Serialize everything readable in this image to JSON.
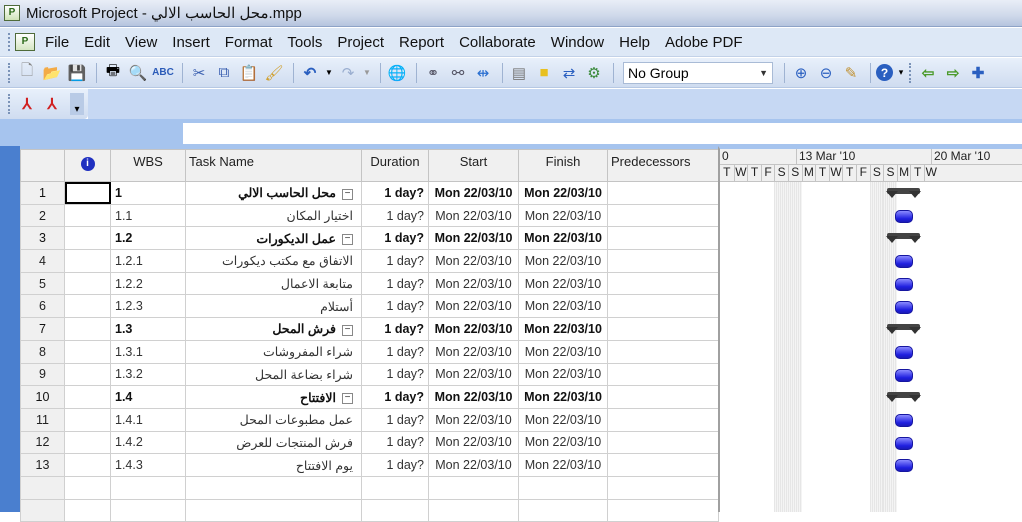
{
  "window": {
    "title": "Microsoft Project - محل الحاسب الالي.mpp",
    "icon": "project-icon"
  },
  "menu": {
    "items": [
      "File",
      "Edit",
      "View",
      "Insert",
      "Format",
      "Tools",
      "Project",
      "Report",
      "Collaborate",
      "Window",
      "Help",
      "Adobe PDF"
    ]
  },
  "toolbar": {
    "left_icons": [
      "new-icon",
      "open-icon",
      "save-icon",
      "print-icon",
      "print-preview-icon",
      "spelling-icon",
      "cut-icon",
      "copy-icon",
      "paste-icon",
      "format-painter-icon",
      "undo-icon",
      "redo-icon",
      "insert-hyperlink-icon",
      "link-tasks-icon",
      "unlink-tasks-icon",
      "split-task-icon",
      "task-information-icon",
      "task-notes-icon",
      "assign-resources-icon",
      "publish-icon"
    ],
    "group_combo": {
      "value": "No Group"
    },
    "right_icons": [
      "zoom-in-icon",
      "zoom-out-icon",
      "go-to-task-icon",
      "help-icon",
      "scroll-left-icon",
      "scroll-right-icon",
      "add-icon"
    ]
  },
  "pdf_toolbar": {
    "icons": [
      "convert-to-pdf-icon",
      "convert-and-comment-pdf-icon"
    ]
  },
  "grid": {
    "columns": [
      "",
      "i",
      "WBS",
      "Task Name",
      "Duration",
      "Start",
      "Finish",
      "Predecessors"
    ],
    "rows": [
      {
        "id": "1",
        "wbs": "1",
        "name": "محل الحاسب الالي",
        "duration": "1 day?",
        "start": "Mon 22/03/10",
        "finish": "Mon 22/03/10",
        "predecessors": "",
        "summary": true
      },
      {
        "id": "2",
        "wbs": "1.1",
        "name": "اختيار المكان",
        "duration": "1 day?",
        "start": "Mon 22/03/10",
        "finish": "Mon 22/03/10",
        "predecessors": "",
        "summary": false
      },
      {
        "id": "3",
        "wbs": "1.2",
        "name": "عمل الديكورات",
        "duration": "1 day?",
        "start": "Mon 22/03/10",
        "finish": "Mon 22/03/10",
        "predecessors": "",
        "summary": true
      },
      {
        "id": "4",
        "wbs": "1.2.1",
        "name": "الاتفاق مع مكتب ديكورات",
        "duration": "1 day?",
        "start": "Mon 22/03/10",
        "finish": "Mon 22/03/10",
        "predecessors": "",
        "summary": false
      },
      {
        "id": "5",
        "wbs": "1.2.2",
        "name": "متابعة الاعمال",
        "duration": "1 day?",
        "start": "Mon 22/03/10",
        "finish": "Mon 22/03/10",
        "predecessors": "",
        "summary": false
      },
      {
        "id": "6",
        "wbs": "1.2.3",
        "name": "أستلام",
        "duration": "1 day?",
        "start": "Mon 22/03/10",
        "finish": "Mon 22/03/10",
        "predecessors": "",
        "summary": false
      },
      {
        "id": "7",
        "wbs": "1.3",
        "name": "فرش المحل",
        "duration": "1 day?",
        "start": "Mon 22/03/10",
        "finish": "Mon 22/03/10",
        "predecessors": "",
        "summary": true
      },
      {
        "id": "8",
        "wbs": "1.3.1",
        "name": "شراء المفروشات",
        "duration": "1 day?",
        "start": "Mon 22/03/10",
        "finish": "Mon 22/03/10",
        "predecessors": "",
        "summary": false
      },
      {
        "id": "9",
        "wbs": "1.3.2",
        "name": "شراء بضاعة المحل",
        "duration": "1 day?",
        "start": "Mon 22/03/10",
        "finish": "Mon 22/03/10",
        "predecessors": "",
        "summary": false
      },
      {
        "id": "10",
        "wbs": "1.4",
        "name": "الافتتاح",
        "duration": "1 day?",
        "start": "Mon 22/03/10",
        "finish": "Mon 22/03/10",
        "predecessors": "",
        "summary": true
      },
      {
        "id": "11",
        "wbs": "1.4.1",
        "name": "عمل مطبوعات المحل",
        "duration": "1 day?",
        "start": "Mon 22/03/10",
        "finish": "Mon 22/03/10",
        "predecessors": "",
        "summary": false
      },
      {
        "id": "12",
        "wbs": "1.4.2",
        "name": "فرش المنتجات للعرض",
        "duration": "1 day?",
        "start": "Mon 22/03/10",
        "finish": "Mon 22/03/10",
        "predecessors": "",
        "summary": false
      },
      {
        "id": "13",
        "wbs": "1.4.3",
        "name": "يوم الافتتاح",
        "duration": "1 day?",
        "start": "Mon 22/03/10",
        "finish": "Mon 22/03/10",
        "predecessors": "",
        "summary": false
      }
    ]
  },
  "gantt": {
    "weeks": [
      "0",
      "13 Mar '10",
      "20 Mar '10"
    ],
    "days": [
      "T",
      "W",
      "T",
      "F",
      "S",
      "S",
      "M",
      "T",
      "W",
      "T",
      "F",
      "S",
      "S",
      "M",
      "T",
      "W"
    ],
    "weekend_indices": [
      4,
      5,
      11,
      12
    ],
    "bar_day_index": 13
  }
}
